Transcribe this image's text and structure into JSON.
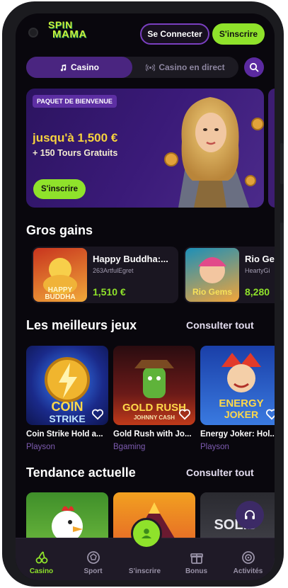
{
  "header": {
    "logo_line1": "SPIN",
    "logo_line2": "MAMA",
    "login_label": "Se Connecter",
    "signup_label": "S'inscrire"
  },
  "tabs": [
    {
      "label": "Casino",
      "active": true
    },
    {
      "label": "Casino en direct",
      "active": false
    }
  ],
  "promo": {
    "badge": "PAQUET DE BIENVENUE",
    "title": "jusqu'à 1,500 €",
    "subtitle": "+ 150 Tours Gratuits",
    "button": "S'inscrire"
  },
  "big_wins": {
    "title": "Gros gains",
    "items": [
      {
        "game": "Happy Buddha:...",
        "user": "263ArtfulEgret",
        "amount": "1,510 €"
      },
      {
        "game": "Rio Ge",
        "user": "HeartyGi",
        "amount": "8,280"
      }
    ]
  },
  "best_games": {
    "title": "Les meilleurs jeux",
    "see_all": "Consulter tout",
    "items": [
      {
        "name": "Coin Strike Hold a...",
        "provider": "Playson"
      },
      {
        "name": "Gold Rush with Jo...",
        "provider": "Bgaming"
      },
      {
        "name": "Energy Joker: Hol...",
        "provider": "Playson"
      }
    ]
  },
  "trending": {
    "title": "Tendance actuelle",
    "see_all": "Consulter tout"
  },
  "nav": [
    {
      "label": "Casino",
      "icon": "cherries-icon",
      "active": true
    },
    {
      "label": "Sport",
      "icon": "ball-icon",
      "active": false
    },
    {
      "label": "S'inscrire",
      "icon": "user-icon",
      "active": false
    },
    {
      "label": "Bonus",
      "icon": "gift-icon",
      "active": false
    },
    {
      "label": "Activités",
      "icon": "target-icon",
      "active": false
    }
  ],
  "colors": {
    "accent_green": "#8fe22b",
    "purple": "#4a2580",
    "background": "#09070d",
    "gold": "#f7d23e"
  }
}
